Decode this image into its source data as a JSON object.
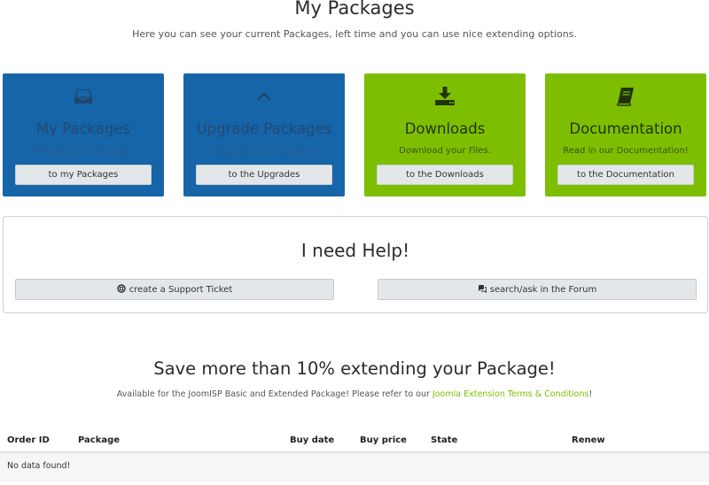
{
  "header": {
    "title": "My Packages",
    "subtitle": "Here you can see your current Packages, left time and you can use nice extending options."
  },
  "tiles": [
    {
      "title": "My Packages",
      "description": "Manage your Packages.",
      "button": "to my Packages",
      "icon": "inbox-icon",
      "color": "#1565a8"
    },
    {
      "title": "Upgrade Packages",
      "description": "Expand your Package!",
      "button": "to the Upgrades",
      "icon": "chevron-up-icon",
      "color": "#1565a8"
    },
    {
      "title": "Downloads",
      "description": "Download your Files.",
      "button": "to the Downloads",
      "icon": "download-icon",
      "color": "#7dbf00"
    },
    {
      "title": "Documentation",
      "description": "Read in our Documentation!",
      "button": "to the Documentation",
      "icon": "book-icon",
      "color": "#7dbf00"
    }
  ],
  "help": {
    "title": "I need Help!",
    "ticket_button": "create a Support Ticket",
    "ticket_icon": "lifebuoy-icon",
    "forum_button": "search/ask in the Forum",
    "forum_icon": "chat-icon"
  },
  "promo": {
    "title": "Save more than 10% extending your Package!",
    "text_before": "Available for the JoomISP Basic and Extended Package! Please refer to our ",
    "link": "Joomla Extension Terms & Conditions",
    "text_after": "!"
  },
  "table": {
    "columns": [
      "Order ID",
      "Package",
      "Buy date",
      "Buy price",
      "State",
      "Renew"
    ],
    "empty_text": "No data found!"
  }
}
